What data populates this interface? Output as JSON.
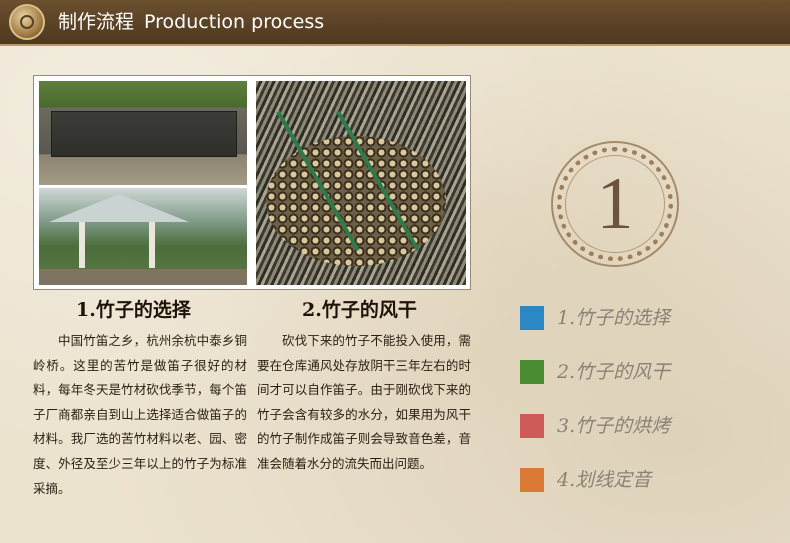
{
  "header": {
    "title_cn": "制作流程",
    "title_en": "Production process"
  },
  "sections": [
    {
      "title": "1.竹子的选择",
      "body": "中国竹笛之乡，杭州余杭中泰乡铜岭桥。这里的苦竹是做笛子很好的材料，每年冬天是竹材砍伐季节，每个笛子厂商都亲自到山上选择适合做笛子的材料。我厂选的苦竹材料以老、园、密度、外径及至少三年以上的竹子为标准采摘。"
    },
    {
      "title": "2.竹子的风干",
      "body": "砍伐下来的竹子不能投入使用，需要在仓库通风处存放阴干三年左右的时间才可以自作笛子。由于刚砍伐下来的竹子会含有较多的水分，如果用为风干的竹子制作成笛子则会导致音色差，音准会随着水分的流失而出问题。"
    }
  ],
  "step_number": "1",
  "steps": [
    {
      "label": "1.竹子的选择",
      "color": "#2a88c4"
    },
    {
      "label": "2.竹子的风干",
      "color": "#4a8c32"
    },
    {
      "label": "3.竹子的烘烤",
      "color": "#cf5a5a"
    },
    {
      "label": "4.划线定音",
      "color": "#dc7a35"
    }
  ]
}
